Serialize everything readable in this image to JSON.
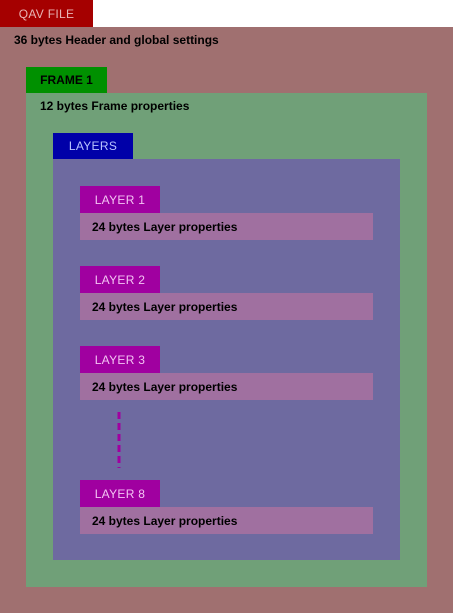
{
  "colors": {
    "file_tab": "#a50000",
    "file_box": "#a07070",
    "frame_tab": "#009000",
    "frame_box": "#70a078",
    "layers_tab": "#0000a8",
    "layers_box": "#6e6aa0",
    "layer_tab": "#a000a0",
    "layer_props": "#a070a0",
    "ellipsis": "#a000a0"
  },
  "file": {
    "title": "QAV FILE",
    "description": "36 bytes Header and global settings"
  },
  "frame": {
    "title": "FRAME 1",
    "description": "12 bytes Frame properties"
  },
  "layers": {
    "title": "LAYERS",
    "items": [
      {
        "title": "LAYER 1",
        "description": "24 bytes Layer properties"
      },
      {
        "title": "LAYER 2",
        "description": "24 bytes Layer properties"
      },
      {
        "title": "LAYER 3",
        "description": "24 bytes Layer properties"
      },
      {
        "title": "LAYER 8",
        "description": "24 bytes Layer properties"
      }
    ]
  }
}
